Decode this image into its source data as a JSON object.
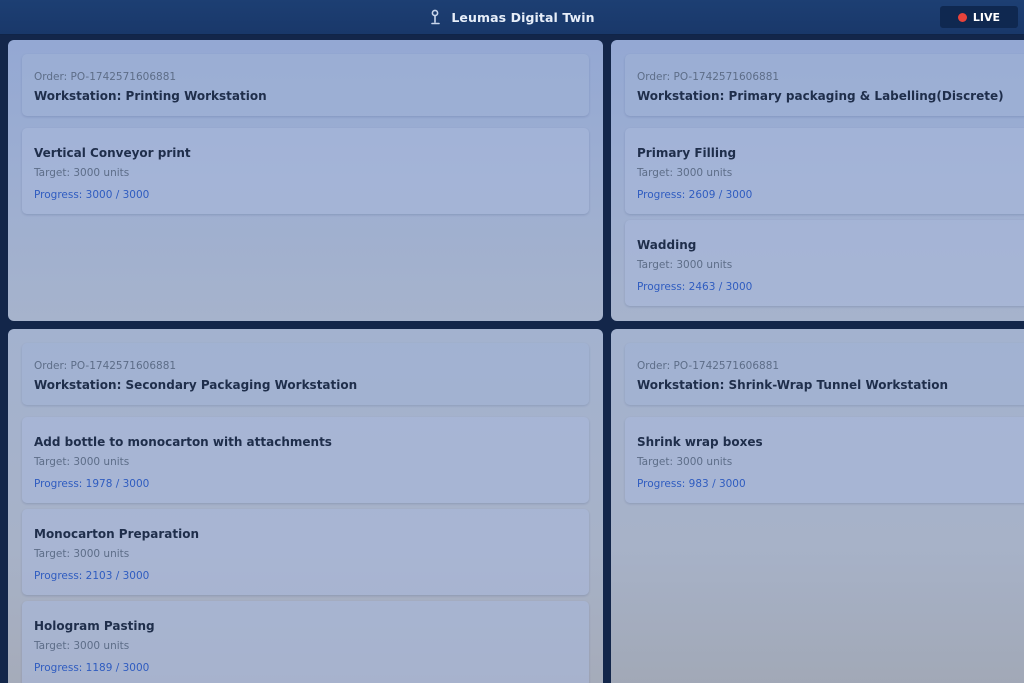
{
  "header": {
    "title": "Leumas Digital Twin",
    "live_label": "LIVE",
    "icon": "user-pin-icon",
    "colors": {
      "bar": "#1d3f73",
      "live_dot": "#e8433b"
    }
  },
  "target_label": "Target: 3000 units",
  "panels": [
    {
      "order": "Order: PO-1742571606881",
      "workstation": "Workstation: Printing Workstation",
      "tasks": [
        {
          "name": "Vertical Conveyor print",
          "target": "Target: 3000 units",
          "progress": "Progress: 3000 / 3000"
        }
      ]
    },
    {
      "order": "Order: PO-1742571606881",
      "workstation": "Workstation: Primary packaging & Labelling(Discrete)",
      "tasks": [
        {
          "name": "Primary Filling",
          "target": "Target: 3000 units",
          "progress": "Progress: 2609 / 3000"
        },
        {
          "name": "Wadding",
          "target": "Target: 3000 units",
          "progress": "Progress: 2463 / 3000"
        }
      ]
    },
    {
      "order": "Order: PO-1742571606881",
      "workstation": "Workstation: Secondary Packaging Workstation",
      "tasks": [
        {
          "name": "Add bottle to monocarton with attachments",
          "target": "Target: 3000 units",
          "progress": "Progress: 1978 / 3000"
        },
        {
          "name": "Monocarton Preparation",
          "target": "Target: 3000 units",
          "progress": "Progress: 2103 / 3000"
        },
        {
          "name": "Hologram Pasting",
          "target": "Target: 3000 units",
          "progress": "Progress: 1189 / 3000"
        }
      ]
    },
    {
      "order": "Order: PO-1742571606881",
      "workstation": "Workstation: Shrink-Wrap Tunnel Workstation",
      "tasks": [
        {
          "name": "Shrink wrap boxes",
          "target": "Target: 3000 units",
          "progress": "Progress: 983 / 3000"
        }
      ]
    }
  ]
}
